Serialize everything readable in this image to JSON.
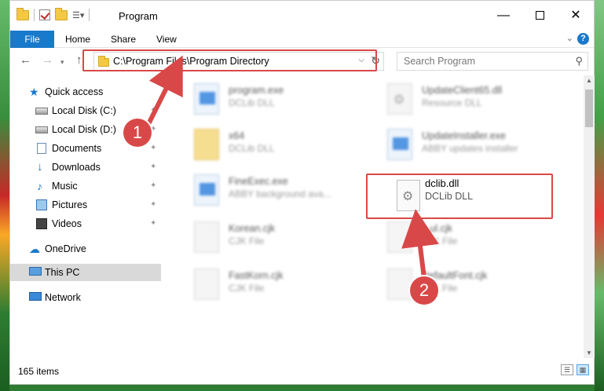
{
  "window": {
    "title": "Program",
    "minimize": "—",
    "close": "✕"
  },
  "ribbon": {
    "tabs": [
      "File",
      "Home",
      "Share",
      "View"
    ],
    "chevron_icon": "chevron-down-icon",
    "help_icon": "help-icon",
    "help_glyph": "?"
  },
  "nav": {
    "back_glyph": "←",
    "forward_glyph": "→",
    "recent_glyph": "▾",
    "up_glyph": "↑",
    "address": "C:\\Program Files\\Program Directory",
    "address_dropdown_glyph": "⌵",
    "refresh_glyph": "↻",
    "search_placeholder": "Search Program",
    "search_glyph": "⚲"
  },
  "sidebar": {
    "items": [
      {
        "label": "Quick access",
        "icon": "star-icon"
      },
      {
        "label": "Local Disk (C:)",
        "icon": "disk-icon",
        "pinned": true
      },
      {
        "label": "Local Disk (D:)",
        "icon": "disk-icon",
        "pinned": true
      },
      {
        "label": "Documents",
        "icon": "documents-icon",
        "pinned": true
      },
      {
        "label": "Downloads",
        "icon": "downloads-icon",
        "pinned": true
      },
      {
        "label": "Music",
        "icon": "music-icon",
        "pinned": true
      },
      {
        "label": "Pictures",
        "icon": "pictures-icon",
        "pinned": true
      },
      {
        "label": "Videos",
        "icon": "videos-icon",
        "pinned": true
      },
      {
        "label": "OneDrive",
        "icon": "onedrive-icon"
      },
      {
        "label": "This PC",
        "icon": "pc-icon",
        "selected": true
      },
      {
        "label": "Network",
        "icon": "network-icon"
      }
    ],
    "pin_glyph": "📌"
  },
  "files": [
    {
      "name": "program.exe",
      "desc": "DCLib DLL",
      "icon": "exe-icon"
    },
    {
      "name": "UpdateClient65.dll",
      "desc": "Resource DLL",
      "icon": "dll-icon"
    },
    {
      "name": "x64",
      "desc": "DCLib DLL",
      "icon": "folder-icon"
    },
    {
      "name": "UpdateInstaller.exe",
      "desc": "ABBY updates installer",
      "icon": "exe-icon"
    },
    {
      "name": "FineExec.exe",
      "desc": "ABBY background ava...",
      "icon": "exe-icon"
    },
    {
      "name": "Korean.cjk",
      "desc": "CJK File",
      "icon": "file-icon"
    },
    {
      "name": "...ul.cjk",
      "desc": "CJK File",
      "icon": "file-icon"
    },
    {
      "name": "FastKorn.cjk",
      "desc": "CJK File",
      "icon": "file-icon"
    },
    {
      "name": "DefaultFont.cjk",
      "desc": "CJK File",
      "icon": "file-icon"
    }
  ],
  "highlighted_file": {
    "name": "dclib.dll",
    "desc": "DCLib DLL",
    "icon": "dll-icon"
  },
  "callouts": [
    "1",
    "2"
  ],
  "status": {
    "items_count": "165 items"
  },
  "colors": {
    "accent": "#1979ca",
    "highlight_red": "#d94848"
  }
}
